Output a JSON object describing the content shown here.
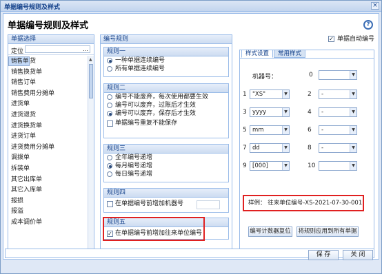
{
  "window": {
    "title": "单据编号规则及样式",
    "close": "×"
  },
  "page": {
    "title": "单据编号规则及样式",
    "help": "?"
  },
  "left": {
    "header": "单据选择",
    "locate_label": "定位",
    "locate_value": "…",
    "items": [
      "销售单",
      "销售退货",
      "销售换货单",
      "销售订单",
      "销售费用分摊单",
      "进货单",
      "进货退货",
      "进货换货单",
      "进货订单",
      "进货费用分摊单",
      "调拨单",
      "拆装单",
      "其它出库单",
      "其它入库单",
      "报损",
      "报溢",
      "成本调价单"
    ]
  },
  "middle": {
    "header": "编号规则",
    "rule1": {
      "title": "规则一",
      "options": [
        "一种单据连续编号",
        "所有单据连续编号"
      ],
      "selected": 0
    },
    "rule2": {
      "title": "规则二",
      "options": [
        "编号不能废弃，每次使用都要生效",
        "编号可以废弃，过账后才生效",
        "编号可以废弃，保存后才生效"
      ],
      "selected": 2,
      "checkbox": "单据编号重复不能保存",
      "checked": false
    },
    "rule3": {
      "title": "规则三",
      "options": [
        "全年编号递增",
        "每月编号递增",
        "每日编号递增"
      ],
      "selected": 1
    },
    "rule4": {
      "title": "规则四",
      "checkbox": "在单据编号前增加机器号",
      "checked": false
    },
    "rule5": {
      "title": "规则五",
      "checkbox": "在单据编号前增加往来单位编号",
      "checked": true
    }
  },
  "right": {
    "auto_label": "单据自动编号",
    "auto_checked": true,
    "tabs": [
      "样式设置",
      "常用样式"
    ],
    "machine_label": "机器号：",
    "machine_value": "0",
    "slots": [
      {
        "n": "1",
        "v": "\"XS\""
      },
      {
        "n": "2",
        "v": "-"
      },
      {
        "n": "3",
        "v": "yyyy"
      },
      {
        "n": "4",
        "v": "-"
      },
      {
        "n": "5",
        "v": "mm"
      },
      {
        "n": "6",
        "v": "-"
      },
      {
        "n": "7",
        "v": "dd"
      },
      {
        "n": "8",
        "v": "-"
      },
      {
        "n": "9",
        "v": "[000]"
      },
      {
        "n": "10",
        "v": ""
      }
    ],
    "sample": "样例：  往来单位编号-XS-2021-07-30-001",
    "btn_reset": "编号计数器复位",
    "btn_apply": "将规则应用到所有单据"
  },
  "footer": {
    "save": "保 存",
    "close": "关 闭"
  }
}
